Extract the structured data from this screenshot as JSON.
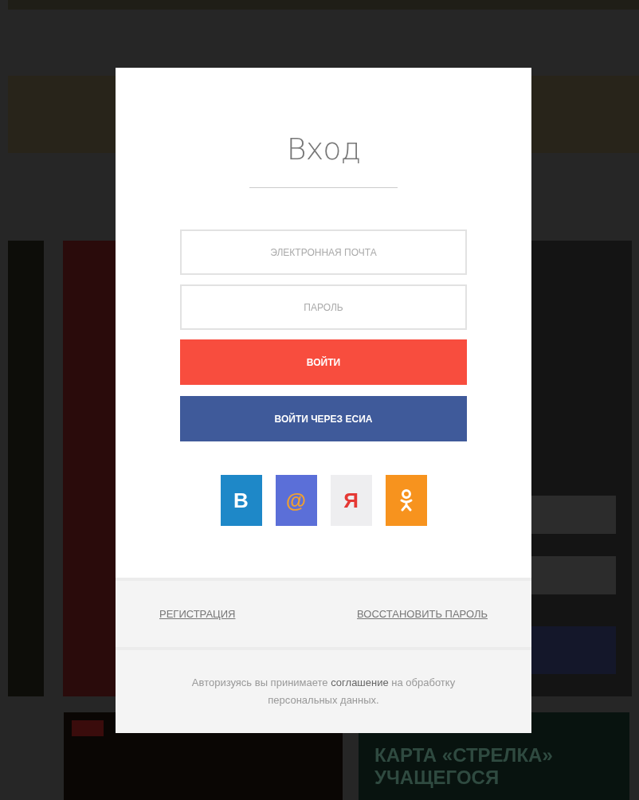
{
  "background": {
    "card_title": [
      "КАРТА «СТРЕЛКА»",
      "УЧАЩЕГОСЯ"
    ]
  },
  "modal": {
    "title": "Вход",
    "fields": [
      {
        "placeholder": "ЭЛЕКТРОННАЯ ПОЧТА"
      },
      {
        "placeholder": "ПАРОЛЬ"
      }
    ],
    "buttons": [
      {
        "kind": "primary",
        "label": "ВОЙТИ"
      },
      {
        "kind": "esia",
        "label": "ВОЙТИ ЧЕРЕЗ ЕСИА"
      }
    ],
    "social": [
      {
        "kind": "vk",
        "label": "B",
        "color": "#1e88c8"
      },
      {
        "kind": "mail",
        "label": "@",
        "color": "#5b6fd8"
      },
      {
        "kind": "yandex",
        "label": "Я",
        "color": "#eeeef0"
      },
      {
        "kind": "ok",
        "color": "#f7931e"
      }
    ],
    "links": [
      "РЕГИСТРАЦИЯ",
      "ВОССТАНОВИТЬ ПАРОЛЬ"
    ],
    "agreement": {
      "before": "Авторизуясь вы принимаете ",
      "link": "соглашение",
      "after": " на обработку персональных данных."
    }
  }
}
